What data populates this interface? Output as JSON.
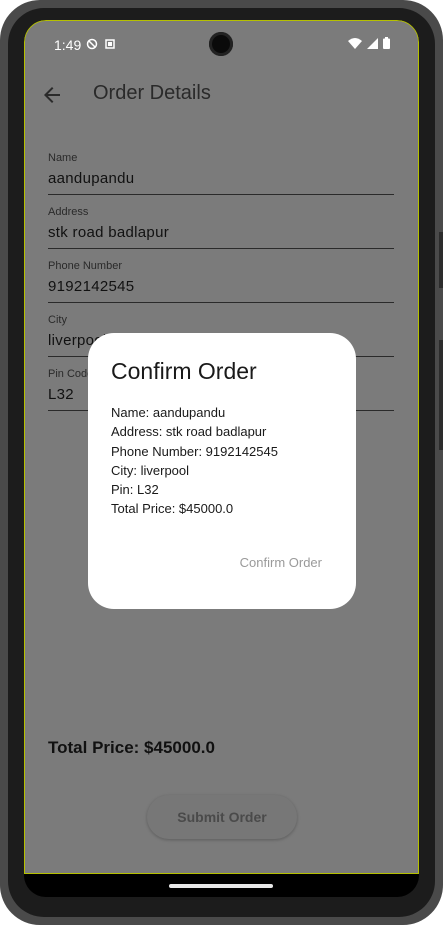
{
  "status_bar": {
    "time": "1:49"
  },
  "app_bar": {
    "title": "Order Details"
  },
  "form": {
    "fields": [
      {
        "label": "Name",
        "value": "aandupandu"
      },
      {
        "label": "Address",
        "value": "stk road badlapur"
      },
      {
        "label": "Phone Number",
        "value": "9192142545"
      },
      {
        "label": "City",
        "value": "liverpool"
      },
      {
        "label": "Pin Code",
        "value": "L32"
      }
    ]
  },
  "total_price": "Total Price: $45000.0",
  "submit_button": "Submit Order",
  "dialog": {
    "title": "Confirm Order",
    "lines": [
      "Name: aandupandu",
      "Address: stk road badlapur",
      "Phone Number: 9192142545",
      "City: liverpool",
      "Pin: L32",
      "Total Price: $45000.0"
    ],
    "confirm_label": "Confirm Order"
  },
  "colors": {
    "scrim_background": "#7b7b7b",
    "dialog_background": "#ffffff",
    "device_frame": "#4a4a4a",
    "screen_border_accent": "#b5c000"
  }
}
